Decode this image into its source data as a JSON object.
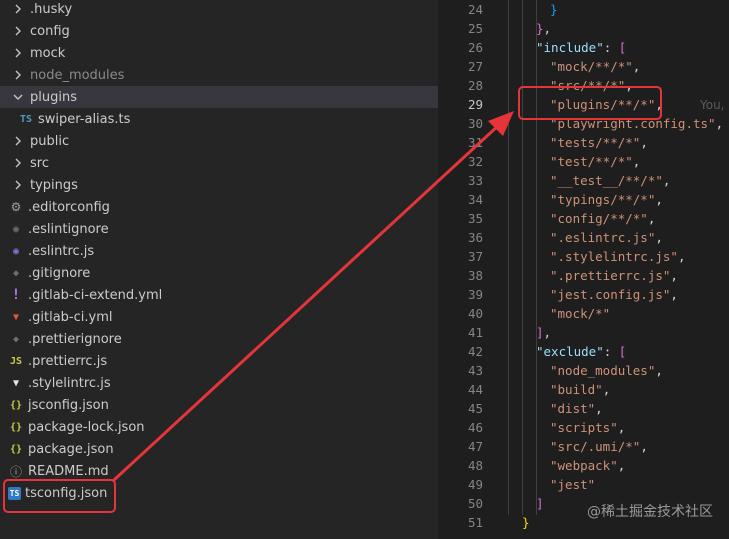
{
  "explorer": {
    "items": [
      {
        "label": ".husky",
        "kind": "folder",
        "expanded": false,
        "icon": "chevron-right-icon",
        "dim": false
      },
      {
        "label": "config",
        "kind": "folder",
        "expanded": false,
        "icon": "chevron-right-icon",
        "dim": false
      },
      {
        "label": "mock",
        "kind": "folder",
        "expanded": false,
        "icon": "chevron-right-icon",
        "dim": false
      },
      {
        "label": "node_modules",
        "kind": "folder",
        "expanded": false,
        "icon": "chevron-right-icon",
        "dim": true
      },
      {
        "label": "plugins",
        "kind": "folder",
        "expanded": true,
        "icon": "chevron-down-icon",
        "dim": false,
        "selected": true
      },
      {
        "label": "swiper-alias.ts",
        "kind": "file",
        "icon": "typescript-icon",
        "glyph": "TS",
        "dim": false
      },
      {
        "label": "public",
        "kind": "folder",
        "expanded": false,
        "icon": "chevron-right-icon",
        "dim": false
      },
      {
        "label": "src",
        "kind": "folder",
        "expanded": false,
        "icon": "chevron-right-icon",
        "dim": false
      },
      {
        "label": "typings",
        "kind": "folder",
        "expanded": false,
        "icon": "chevron-right-icon",
        "dim": false
      },
      {
        "label": ".editorconfig",
        "kind": "file",
        "icon": "gear-icon",
        "glyph": "⚙",
        "dim": false
      },
      {
        "label": ".eslintignore",
        "kind": "file",
        "icon": "eslint-ignore-icon",
        "glyph": "◉",
        "dim": false
      },
      {
        "label": ".eslintrc.js",
        "kind": "file",
        "icon": "eslint-icon",
        "glyph": "◉",
        "dim": false
      },
      {
        "label": ".gitignore",
        "kind": "file",
        "icon": "git-icon",
        "glyph": "◆",
        "dim": false
      },
      {
        "label": ".gitlab-ci-extend.yml",
        "kind": "file",
        "icon": "exclamation-icon",
        "glyph": "!",
        "dim": false
      },
      {
        "label": ".gitlab-ci.yml",
        "kind": "file",
        "icon": "gitlab-icon",
        "glyph": "▼",
        "dim": false
      },
      {
        "label": ".prettierignore",
        "kind": "file",
        "icon": "prettier-ignore-icon",
        "glyph": "◆",
        "dim": false
      },
      {
        "label": ".prettierrc.js",
        "kind": "file",
        "icon": "javascript-icon",
        "glyph": "JS",
        "dim": false
      },
      {
        "label": ".stylelintrc.js",
        "kind": "file",
        "icon": "stylelint-icon",
        "glyph": "▼",
        "dim": false
      },
      {
        "label": "jsconfig.json",
        "kind": "file",
        "icon": "json-icon",
        "glyph": "{}",
        "dim": false
      },
      {
        "label": "package-lock.json",
        "kind": "file",
        "icon": "json-icon",
        "glyph": "{}",
        "dim": false
      },
      {
        "label": "package.json",
        "kind": "file",
        "icon": "json-icon",
        "glyph": "{}",
        "dim": false
      },
      {
        "label": "README.md",
        "kind": "file",
        "icon": "info-icon",
        "glyph": "ⓘ",
        "dim": false
      },
      {
        "label": "tsconfig.json",
        "kind": "file",
        "icon": "tsconfig-icon",
        "glyph": "TS",
        "dim": false,
        "highlighted": true
      }
    ]
  },
  "editor": {
    "current_line": 29,
    "ghost_text": "You,",
    "lines": [
      {
        "n": 24,
        "indent": 3,
        "tokens": [
          [
            "}",
            "br2"
          ]
        ]
      },
      {
        "n": 25,
        "indent": 2,
        "tokens": [
          [
            "}",
            "br1"
          ],
          [
            ",",
            "p"
          ]
        ]
      },
      {
        "n": 26,
        "indent": 2,
        "tokens": [
          [
            "\"include\"",
            "key"
          ],
          [
            ": ",
            "p"
          ],
          [
            "[",
            "br1"
          ]
        ]
      },
      {
        "n": 27,
        "indent": 3,
        "tokens": [
          [
            "\"mock/**/*\"",
            "str"
          ],
          [
            ",",
            "p"
          ]
        ]
      },
      {
        "n": 28,
        "indent": 3,
        "tokens": [
          [
            "\"src/**/*\"",
            "str"
          ],
          [
            ",",
            "p"
          ]
        ]
      },
      {
        "n": 29,
        "indent": 3,
        "tokens": [
          [
            "\"plugins/**/*\"",
            "str"
          ],
          [
            ",",
            "p"
          ]
        ]
      },
      {
        "n": 30,
        "indent": 3,
        "tokens": [
          [
            "\"playwright.config.ts\"",
            "str"
          ],
          [
            ",",
            "p"
          ]
        ]
      },
      {
        "n": 31,
        "indent": 3,
        "tokens": [
          [
            "\"tests/**/*\"",
            "str"
          ],
          [
            ",",
            "p"
          ]
        ]
      },
      {
        "n": 32,
        "indent": 3,
        "tokens": [
          [
            "\"test/**/*\"",
            "str"
          ],
          [
            ",",
            "p"
          ]
        ]
      },
      {
        "n": 33,
        "indent": 3,
        "tokens": [
          [
            "\"__test__/**/*\"",
            "str"
          ],
          [
            ",",
            "p"
          ]
        ]
      },
      {
        "n": 34,
        "indent": 3,
        "tokens": [
          [
            "\"typings/**/*\"",
            "str"
          ],
          [
            ",",
            "p"
          ]
        ]
      },
      {
        "n": 35,
        "indent": 3,
        "tokens": [
          [
            "\"config/**/*\"",
            "str"
          ],
          [
            ",",
            "p"
          ]
        ]
      },
      {
        "n": 36,
        "indent": 3,
        "tokens": [
          [
            "\".eslintrc.js\"",
            "str"
          ],
          [
            ",",
            "p"
          ]
        ]
      },
      {
        "n": 37,
        "indent": 3,
        "tokens": [
          [
            "\".stylelintrc.js\"",
            "str"
          ],
          [
            ",",
            "p"
          ]
        ]
      },
      {
        "n": 38,
        "indent": 3,
        "tokens": [
          [
            "\".prettierrc.js\"",
            "str"
          ],
          [
            ",",
            "p"
          ]
        ]
      },
      {
        "n": 39,
        "indent": 3,
        "tokens": [
          [
            "\"jest.config.js\"",
            "str"
          ],
          [
            ",",
            "p"
          ]
        ]
      },
      {
        "n": 40,
        "indent": 3,
        "tokens": [
          [
            "\"mock/*\"",
            "str"
          ]
        ]
      },
      {
        "n": 41,
        "indent": 2,
        "tokens": [
          [
            "]",
            "br1"
          ],
          [
            ",",
            "p"
          ]
        ]
      },
      {
        "n": 42,
        "indent": 2,
        "tokens": [
          [
            "\"exclude\"",
            "key"
          ],
          [
            ": ",
            "p"
          ],
          [
            "[",
            "br1"
          ]
        ]
      },
      {
        "n": 43,
        "indent": 3,
        "tokens": [
          [
            "\"node_modules\"",
            "str"
          ],
          [
            ",",
            "p"
          ]
        ]
      },
      {
        "n": 44,
        "indent": 3,
        "tokens": [
          [
            "\"build\"",
            "str"
          ],
          [
            ",",
            "p"
          ]
        ]
      },
      {
        "n": 45,
        "indent": 3,
        "tokens": [
          [
            "\"dist\"",
            "str"
          ],
          [
            ",",
            "p"
          ]
        ]
      },
      {
        "n": 46,
        "indent": 3,
        "tokens": [
          [
            "\"scripts\"",
            "str"
          ],
          [
            ",",
            "p"
          ]
        ]
      },
      {
        "n": 47,
        "indent": 3,
        "tokens": [
          [
            "\"src/.umi/*\"",
            "str"
          ],
          [
            ",",
            "p"
          ]
        ]
      },
      {
        "n": 48,
        "indent": 3,
        "tokens": [
          [
            "\"webpack\"",
            "str"
          ],
          [
            ",",
            "p"
          ]
        ]
      },
      {
        "n": 49,
        "indent": 3,
        "tokens": [
          [
            "\"jest\"",
            "str"
          ]
        ]
      },
      {
        "n": 50,
        "indent": 2,
        "tokens": [
          [
            "]",
            "br1"
          ]
        ]
      },
      {
        "n": 51,
        "indent": 1,
        "tokens": [
          [
            "}",
            "br0"
          ]
        ]
      }
    ]
  },
  "watermark": "@稀土掘金技术社区",
  "colors": {
    "annotation": "#e5353b",
    "string": "#ce9178",
    "key": "#9cdcfe",
    "folder_text": "#cccccc"
  }
}
